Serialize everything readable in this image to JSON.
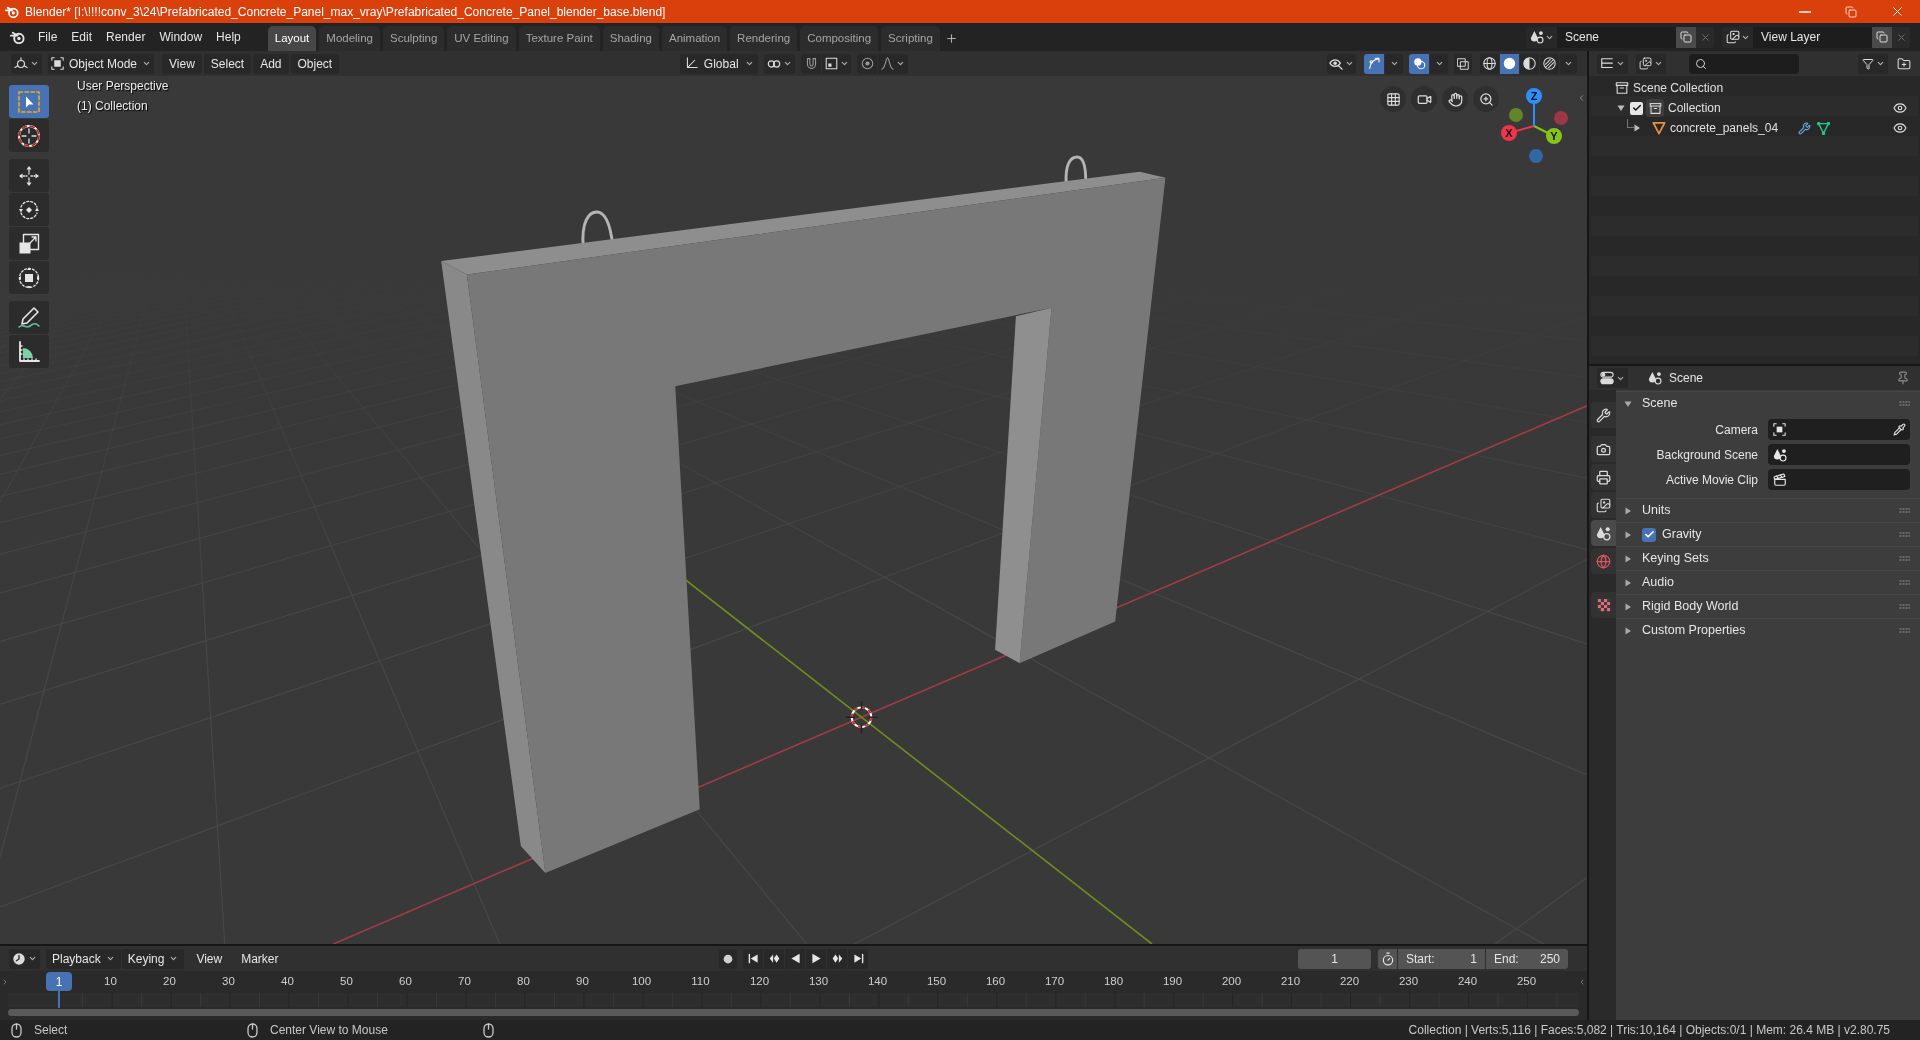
{
  "window": {
    "title": "Blender* [I:\\!!!!conv_3\\24\\Prefabricated_Concrete_Panel_max_vray\\Prefabricated_Concrete_Panel_blender_base.blend]"
  },
  "top_bar": {
    "menu": [
      "File",
      "Edit",
      "Render",
      "Window",
      "Help"
    ],
    "workspaces": [
      {
        "label": "Layout",
        "selected": true
      },
      {
        "label": "Modeling",
        "selected": false
      },
      {
        "label": "Sculpting",
        "selected": false
      },
      {
        "label": "UV Editing",
        "selected": false
      },
      {
        "label": "Texture Paint",
        "selected": false
      },
      {
        "label": "Shading",
        "selected": false
      },
      {
        "label": "Animation",
        "selected": false
      },
      {
        "label": "Rendering",
        "selected": false
      },
      {
        "label": "Compositing",
        "selected": false
      },
      {
        "label": "Scripting",
        "selected": false
      }
    ],
    "scene": "Scene",
    "view_layer": "View Layer"
  },
  "viewport": {
    "header": {
      "mode": "Object Mode",
      "menus": [
        "View",
        "Select",
        "Add",
        "Object"
      ],
      "orientation": "Global",
      "gizmos_on": true,
      "overlays_on": true,
      "xray_on": false,
      "shading_modes": [
        {
          "selected": false
        },
        {
          "selected": true
        },
        {
          "selected": false
        },
        {
          "selected": false
        }
      ]
    },
    "overlay_text": [
      "User Perspective",
      "(1) Collection"
    ],
    "tool_groups": [
      [
        {
          "selected": true
        },
        {
          "selected": false
        }
      ],
      [
        {
          "selected": false
        },
        {
          "selected": false
        },
        {
          "selected": false
        },
        {
          "selected": false
        }
      ],
      [
        {
          "selected": false
        },
        {
          "selected": false
        }
      ]
    ],
    "gizmo_axes": [
      {
        "label": "X",
        "color": "#f0344e"
      },
      {
        "label": "Y",
        "color": "#84c41b"
      },
      {
        "label": "Z",
        "color": "#2c8fff"
      }
    ]
  },
  "outliner": {
    "tree": [
      {
        "label": "Scene Collection",
        "kind": "scene_collection",
        "children": [
          {
            "label": "Collection",
            "kind": "collection",
            "expanded": true,
            "checked": true,
            "visible": true,
            "children": [
              {
                "label": "concrete_panels_04",
                "kind": "mesh_object",
                "expanded": false,
                "visible": true
              }
            ]
          }
        ]
      }
    ]
  },
  "properties": {
    "context": "Scene",
    "tabs": [
      {
        "selected": false
      },
      {
        "selected": false
      },
      {
        "selected": false
      },
      {
        "selected": false
      },
      {
        "selected": true
      },
      {
        "selected": false
      },
      {
        "selected": false
      }
    ],
    "panels": [
      {
        "title": "Scene",
        "kind": "plain",
        "expanded": true,
        "fields": [
          {
            "label": "Camera"
          },
          {
            "label": "Background Scene"
          },
          {
            "label": "Active Movie Clip"
          }
        ]
      },
      {
        "title": "Units",
        "kind": "plain",
        "expanded": false
      },
      {
        "title": "Gravity",
        "kind": "checkbox",
        "checked": true,
        "expanded": false
      },
      {
        "title": "Keying Sets",
        "kind": "plain",
        "expanded": false
      },
      {
        "title": "Audio",
        "kind": "plain",
        "expanded": false
      },
      {
        "title": "Rigid Body World",
        "kind": "plain",
        "expanded": false
      },
      {
        "title": "Custom Properties",
        "kind": "plain",
        "expanded": false
      }
    ]
  },
  "timeline": {
    "menus": [
      {
        "label": "Playback",
        "kind": "dropdown"
      },
      {
        "label": "Keying",
        "kind": "dropdown"
      },
      {
        "label": "View",
        "kind": "menu"
      },
      {
        "label": "Marker",
        "kind": "menu"
      }
    ],
    "current_frame": "1",
    "start_label": "Start:",
    "start": "1",
    "end_label": "End:",
    "end": "250",
    "playhead": "1",
    "ruler": [
      "10",
      "20",
      "30",
      "40",
      "50",
      "60",
      "70",
      "80",
      "90",
      "100",
      "110",
      "120",
      "130",
      "140",
      "150",
      "160",
      "170",
      "180",
      "190",
      "200",
      "210",
      "220",
      "230",
      "240",
      "250"
    ]
  },
  "status_bar": {
    "hints": [
      "Select",
      "Center View to Mouse"
    ],
    "stats": "Collection | Verts:5,116 | Faces:5,082 | Tris:10,164 | Objects:0/1 | Mem: 26.4 MB | v2.80.75"
  }
}
